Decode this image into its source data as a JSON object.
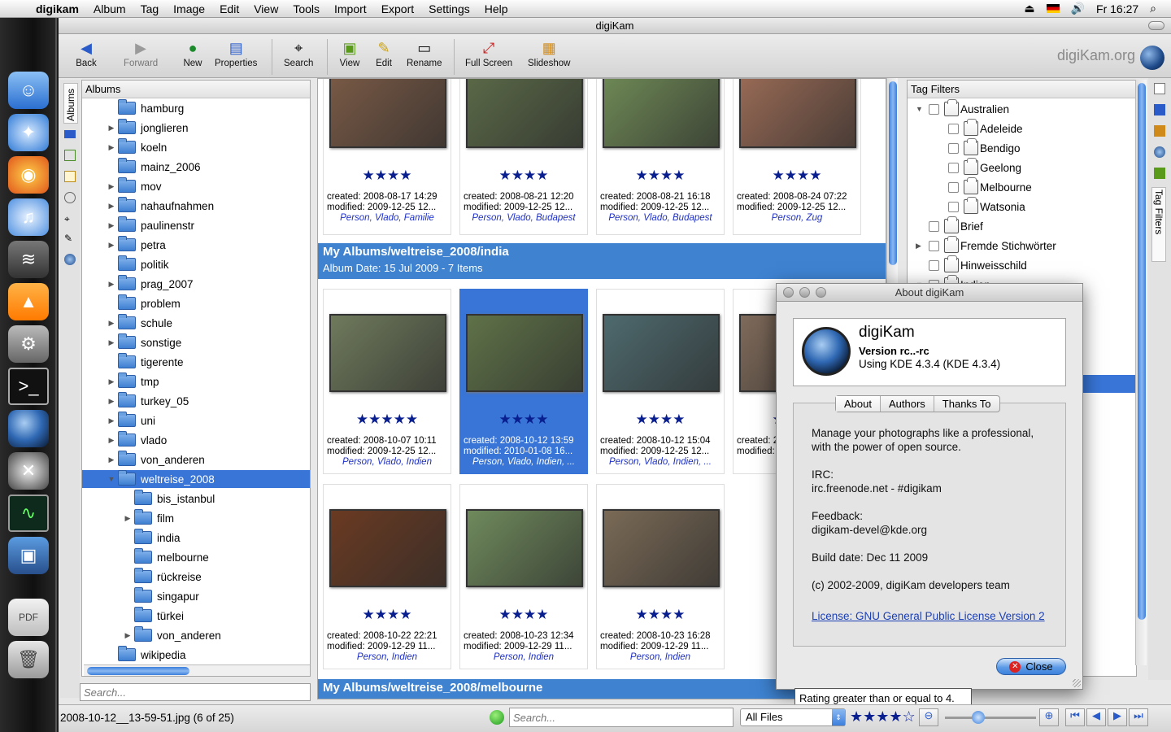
{
  "menubar": {
    "app": "digikam",
    "items": [
      "Album",
      "Tag",
      "Image",
      "Edit",
      "View",
      "Tools",
      "Import",
      "Export",
      "Settings",
      "Help"
    ],
    "clock": "Fr 16:27"
  },
  "window": {
    "title": "digiKam"
  },
  "toolbar": {
    "back": "Back",
    "forward": "Forward",
    "new": "New",
    "properties": "Properties",
    "search": "Search",
    "view": "View",
    "edit": "Edit",
    "rename": "Rename",
    "fullscreen": "Full Screen",
    "slideshow": "Slideshow",
    "brand": "digiKam.org"
  },
  "left_tab": "Albums",
  "albums": {
    "header": "Albums",
    "items": [
      {
        "label": "hamburg",
        "expand": false
      },
      {
        "label": "jonglieren",
        "expand": true
      },
      {
        "label": "koeln",
        "expand": true
      },
      {
        "label": "mainz_2006",
        "expand": false
      },
      {
        "label": "mov",
        "expand": true
      },
      {
        "label": "nahaufnahmen",
        "expand": true
      },
      {
        "label": "paulinenstr",
        "expand": true
      },
      {
        "label": "petra",
        "expand": true
      },
      {
        "label": "politik",
        "expand": false
      },
      {
        "label": "prag_2007",
        "expand": true
      },
      {
        "label": "problem",
        "expand": false
      },
      {
        "label": "schule",
        "expand": true
      },
      {
        "label": "sonstige",
        "expand": true
      },
      {
        "label": "tigerente",
        "expand": false
      },
      {
        "label": "tmp",
        "expand": true
      },
      {
        "label": "turkey_05",
        "expand": true
      },
      {
        "label": "uni",
        "expand": true
      },
      {
        "label": "vlado",
        "expand": true
      },
      {
        "label": "von_anderen",
        "expand": true
      },
      {
        "label": "weltreise_2008",
        "expand": "open",
        "selected": true
      },
      {
        "label": "bis_istanbul",
        "expand": false,
        "child": true
      },
      {
        "label": "film",
        "expand": true,
        "child": true
      },
      {
        "label": "india",
        "expand": false,
        "child": true
      },
      {
        "label": "melbourne",
        "expand": false,
        "child": true
      },
      {
        "label": "rückreise",
        "expand": false,
        "child": true
      },
      {
        "label": "singapur",
        "expand": false,
        "child": true
      },
      {
        "label": "türkei",
        "expand": false,
        "child": true
      },
      {
        "label": "von_anderen",
        "expand": true,
        "child": true
      },
      {
        "label": "wikipedia",
        "expand": false
      }
    ],
    "search_placeholder": "Search..."
  },
  "groups": [
    {
      "title": "My Albums/weltreise_2008/india",
      "subtitle": "Album Date: 15 Jul 2009 - 7 Items"
    },
    {
      "title": "My Albums/weltreise_2008/melbourne"
    }
  ],
  "cards_row1": [
    {
      "stars": "★★★★",
      "created": "created: 2008-08-17 14:29",
      "modified": "modified: 2009-12-25 12...",
      "tags": "Person, Vlado, Familie",
      "color": "#7a5a46"
    },
    {
      "stars": "★★★★",
      "created": "created: 2008-08-21 12:20",
      "modified": "modified: 2009-12-25 12...",
      "tags": "Person, Vlado, Budapest",
      "color": "#5b6a48"
    },
    {
      "stars": "★★★★",
      "created": "created: 2008-08-21 16:18",
      "modified": "modified: 2009-12-25 12...",
      "tags": "Person, Vlado, Budapest",
      "color": "#6f8a56"
    },
    {
      "stars": "★★★★",
      "created": "created: 2008-08-24 07:22",
      "modified": "modified: 2009-12-25 12...",
      "tags": "Person, Zug",
      "color": "#9a6b56"
    }
  ],
  "cards_row2": [
    {
      "stars": "★★★★★",
      "created": "created: 2008-10-07 10:11",
      "modified": "modified: 2009-12-25 12...",
      "tags": "Person, Vlado, Indien",
      "color": "#6f7a5c"
    },
    {
      "stars": "★★★★",
      "created": "created: 2008-10-12 13:59",
      "modified": "modified: 2010-01-08 16...",
      "tags": "Person, Vlado, Indien, ...",
      "color": "#5f7248",
      "selected": true
    },
    {
      "stars": "★★★★",
      "created": "created: 2008-10-12 15:04",
      "modified": "modified: 2009-12-25 12...",
      "tags": "Person, Vlado, Indien, ...",
      "color": "#4e6a6e"
    },
    {
      "stars": "★★★★",
      "created": "created: 2",
      "modified": "modified:",
      "tags": "Perso",
      "color": "#7f6a5a"
    }
  ],
  "cards_row3": [
    {
      "stars": "★★★★",
      "created": "created: 2008-10-22 22:21",
      "modified": "modified: 2009-12-29 11...",
      "tags": "Person, Indien",
      "color": "#6a3a22"
    },
    {
      "stars": "★★★★",
      "created": "created: 2008-10-23 12:34",
      "modified": "modified: 2009-12-29 11...",
      "tags": "Person, Indien",
      "color": "#6f8a5c"
    },
    {
      "stars": "★★★★",
      "created": "created: 2008-10-23 16:28",
      "modified": "modified: 2009-12-29 11...",
      "tags": "Person, Indien",
      "color": "#7a6a56"
    }
  ],
  "tagfilters": {
    "header": "Tag Filters",
    "side_tab": "Tag Filters",
    "items": [
      {
        "label": "Australien",
        "tw": "▼",
        "indent": 0
      },
      {
        "label": "Adeleide",
        "tw": "",
        "indent": 1
      },
      {
        "label": "Bendigo",
        "tw": "",
        "indent": 1
      },
      {
        "label": "Geelong",
        "tw": "",
        "indent": 1
      },
      {
        "label": "Melbourne",
        "tw": "",
        "indent": 1
      },
      {
        "label": "Watsonia",
        "tw": "",
        "indent": 1
      },
      {
        "label": "Brief",
        "tw": "",
        "indent": 0
      },
      {
        "label": "Fremde Stichwörter",
        "tw": "▶",
        "indent": 0
      },
      {
        "label": "Hinweisschild",
        "tw": "",
        "indent": 0
      },
      {
        "label": "Indien",
        "tw": "▼",
        "indent": 0
      }
    ]
  },
  "about": {
    "title": "About digiKam",
    "name": "digiKam",
    "version": "Version rc..-rc",
    "kde": "Using KDE 4.3.4 (KDE 4.3.4)",
    "tabs": [
      "About",
      "Authors",
      "Thanks To"
    ],
    "desc1": "Manage your photographs like a professional,",
    "desc2": "with the power of open source.",
    "irc_label": "IRC:",
    "irc": "irc.freenode.net - #digikam",
    "feedback_label": "Feedback:",
    "feedback": "digikam-devel@kde.org",
    "build": "Build date: Dec 11 2009",
    "copyright": "(c) 2002-2009, digiKam developers team",
    "license": "License: GNU General Public License Version 2",
    "close": "Close"
  },
  "tooltip": "Rating greater than or equal to 4.",
  "status": {
    "filename": "2008-10-12__13-59-51.jpg (6 of 25)",
    "search_placeholder": "Search...",
    "filter": "All Files",
    "rating": "★★★★☆"
  }
}
